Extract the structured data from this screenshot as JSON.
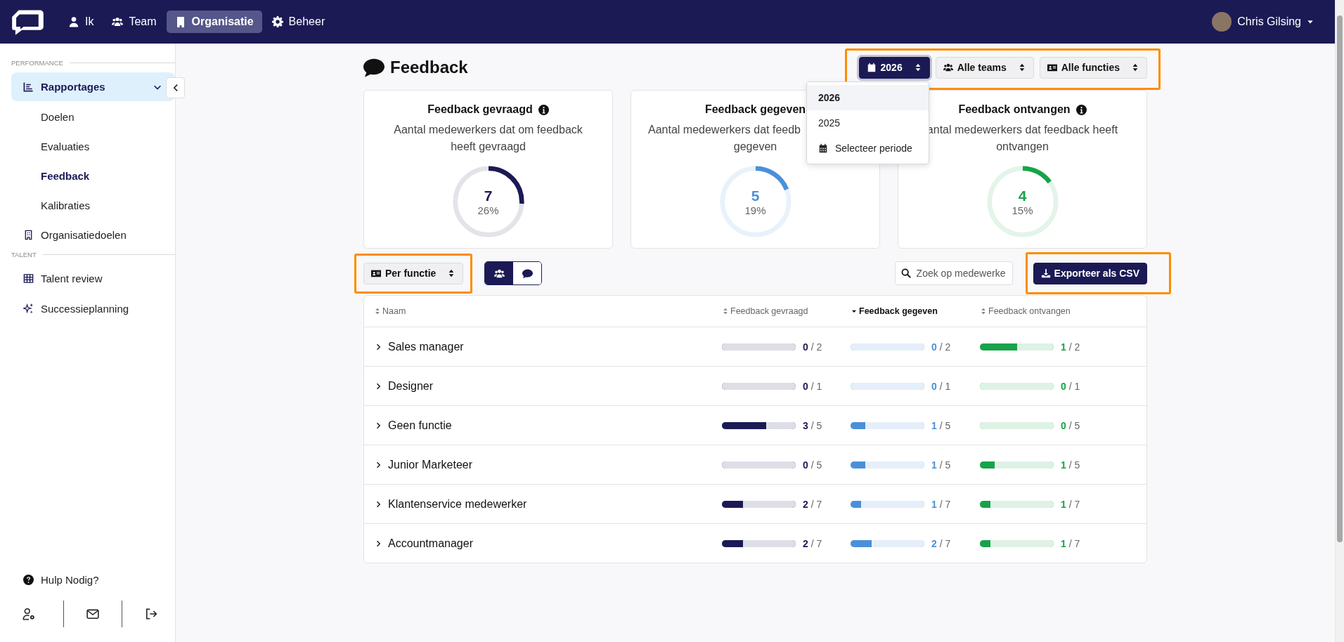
{
  "nav": {
    "items": [
      {
        "label": "Ik",
        "selected": false
      },
      {
        "label": "Team",
        "selected": false
      },
      {
        "label": "Organisatie",
        "selected": true
      },
      {
        "label": "Beheer",
        "selected": false
      }
    ],
    "user": {
      "name": "Chris Gilsing"
    }
  },
  "sidebar": {
    "sections": [
      {
        "heading": "PERFORMANCE",
        "items": [
          {
            "label": "Rapportages",
            "selected": true,
            "expanded": true,
            "children": [
              {
                "label": "Doelen",
                "selected": false
              },
              {
                "label": "Evaluaties",
                "selected": false
              },
              {
                "label": "Feedback",
                "selected": true
              },
              {
                "label": "Kalibraties",
                "selected": false
              }
            ]
          },
          {
            "label": "Organisatiedoelen",
            "selected": false
          }
        ]
      },
      {
        "heading": "TALENT",
        "items": [
          {
            "label": "Talent review",
            "selected": false
          },
          {
            "label": "Successieplanning",
            "selected": false
          }
        ]
      }
    ],
    "help": "Hulp Nodig?"
  },
  "page": {
    "title": "Feedback",
    "filters": {
      "highlighted": true,
      "buttons": [
        {
          "label": "2026",
          "primary": true
        },
        {
          "label": "Alle teams",
          "primary": false
        },
        {
          "label": "Alle functies",
          "primary": false
        }
      ]
    },
    "period_menu": [
      {
        "label": "2026",
        "selected": true
      },
      {
        "label": "2025",
        "selected": false
      },
      {
        "label": "Selecteer periode",
        "selected": false
      }
    ],
    "cards": [
      {
        "title": "Feedback gevraagd",
        "info": true,
        "covered": false,
        "description": [
          "Aantal medewerkers dat om feedback",
          "heeft gevraagd"
        ],
        "count": "7",
        "percent": "26%",
        "level": 0.26,
        "color": "#1b1a55"
      },
      {
        "title": "Feedback gegeven",
        "info": false,
        "covered": true,
        "description": [
          "Aantal medewerkers dat feedb",
          "gegeven"
        ],
        "count": "5",
        "percent": "19%",
        "level": 0.19,
        "color": "#4a90d9"
      },
      {
        "title": "Feedback ontvangen",
        "info": true,
        "covered": false,
        "description": [
          "antal medewerkers dat feedback heeft",
          "ontvangen"
        ],
        "count": "4",
        "percent": "15%",
        "level": 0.15,
        "color": "#17a34a"
      }
    ],
    "group_by": {
      "label": "Per functie",
      "highlighted": true
    },
    "view_toggle": [
      {
        "selected": true
      },
      {
        "selected": false
      }
    ],
    "search": {
      "placeholder": "Zoek op medewerke"
    },
    "export": {
      "label": "Exporteer als CSV",
      "highlighted": true
    },
    "table": {
      "columns": [
        {
          "label": "Naam",
          "sorted": false
        },
        {
          "label": "Feedback gevraagd",
          "sorted": false,
          "color": "#1b1a55"
        },
        {
          "label": "Feedback gegeven",
          "sorted": true,
          "color": "#4a90d9"
        },
        {
          "label": "Feedback ontvangen",
          "sorted": false,
          "color": "#17a34a"
        }
      ],
      "rows": [
        {
          "name": "Sales manager",
          "expanded": false,
          "cells": [
            {
              "count": "0",
              "total": "/ 2",
              "level": 0
            },
            {
              "count": "0",
              "total": "/ 2",
              "level": 0
            },
            {
              "count": "1",
              "total": "/ 2",
              "level": 0.5
            }
          ]
        },
        {
          "name": "Designer",
          "expanded": false,
          "cells": [
            {
              "count": "0",
              "total": "/ 1",
              "level": 0
            },
            {
              "count": "0",
              "total": "/ 1",
              "level": 0
            },
            {
              "count": "0",
              "total": "/ 1",
              "level": 0
            }
          ]
        },
        {
          "name": "Geen functie",
          "expanded": false,
          "cells": [
            {
              "count": "3",
              "total": "/ 5",
              "level": 0.6
            },
            {
              "count": "1",
              "total": "/ 5",
              "level": 0.2
            },
            {
              "count": "0",
              "total": "/ 5",
              "level": 0
            }
          ]
        },
        {
          "name": "Junior Marketeer",
          "expanded": false,
          "cells": [
            {
              "count": "0",
              "total": "/ 5",
              "level": 0
            },
            {
              "count": "1",
              "total": "/ 5",
              "level": 0.2
            },
            {
              "count": "1",
              "total": "/ 5",
              "level": 0.2
            }
          ]
        },
        {
          "name": "Klantenservice medewerker",
          "expanded": false,
          "cells": [
            {
              "count": "2",
              "total": "/ 7",
              "level": 0.286
            },
            {
              "count": "1",
              "total": "/ 7",
              "level": 0.143
            },
            {
              "count": "1",
              "total": "/ 7",
              "level": 0.143
            }
          ]
        },
        {
          "name": "Accountmanager",
          "expanded": false,
          "cells": [
            {
              "count": "2",
              "total": "/ 7",
              "level": 0.286
            },
            {
              "count": "2",
              "total": "/ 7",
              "level": 0.286
            },
            {
              "count": "1",
              "total": "/ 7",
              "level": 0.143
            }
          ]
        }
      ]
    }
  }
}
